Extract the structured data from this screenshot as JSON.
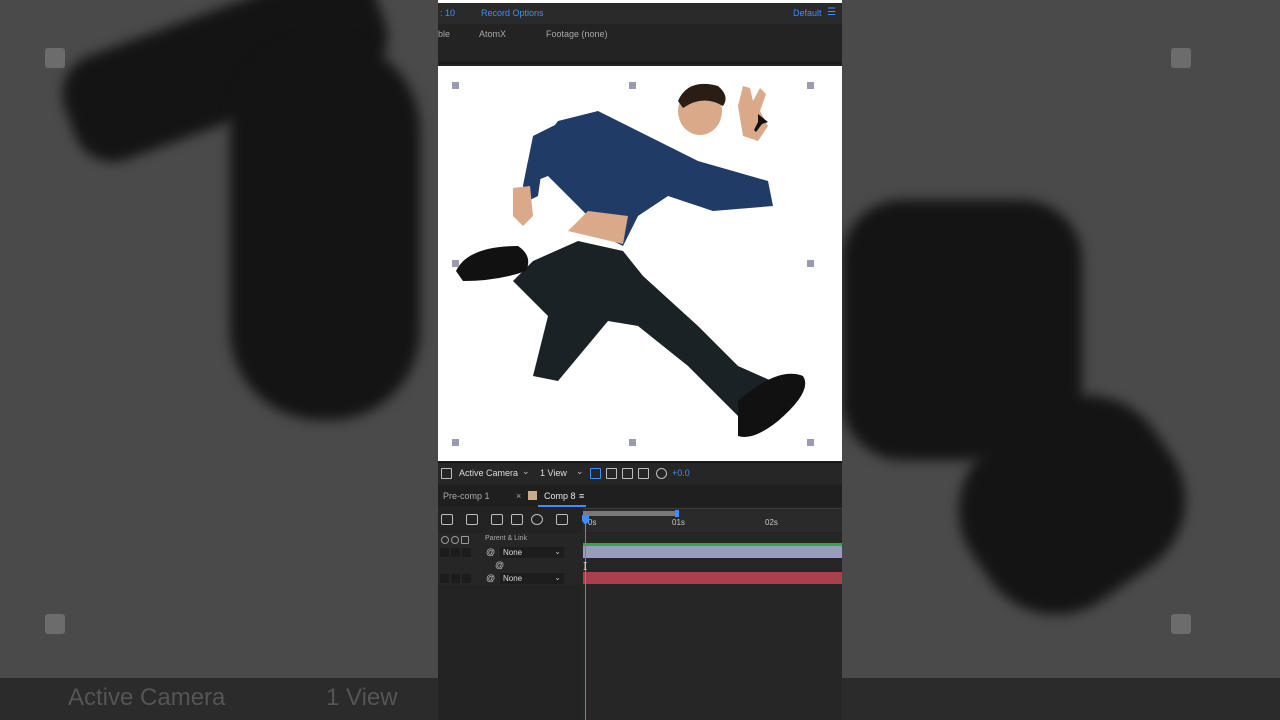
{
  "topbar": {
    "frame_rate_fragment": ": 10",
    "record_options": "Record Options",
    "workspace": "Default",
    "menu_icon": "hamburger-icon"
  },
  "panel_tabs": [
    {
      "label": "ble"
    },
    {
      "label": "AtomX"
    },
    {
      "label": "Footage (none)"
    }
  ],
  "viewer": {
    "content": "man-leaping-photo",
    "background": "#ffffff"
  },
  "viewer_toolbar": {
    "camera": "Active Camera",
    "views": "1 View",
    "exposure": "+0.0"
  },
  "timeline_tabs": [
    {
      "label": "Pre-comp 1",
      "active": false
    },
    {
      "label": "Comp 8",
      "active": true
    }
  ],
  "timeline": {
    "ticks": [
      "0s",
      "01s",
      "02s"
    ],
    "parent_header": "Parent & Link",
    "layers": [
      {
        "parent": "None",
        "bar_color": "#9b9bc0"
      },
      {
        "parent": "None",
        "bar_color": "#a8414c"
      }
    ]
  },
  "bottom_ghost": {
    "camera": "Active Camera",
    "views": "1 View"
  },
  "colors": {
    "accent": "#3d8eff",
    "panel": "#232323"
  }
}
